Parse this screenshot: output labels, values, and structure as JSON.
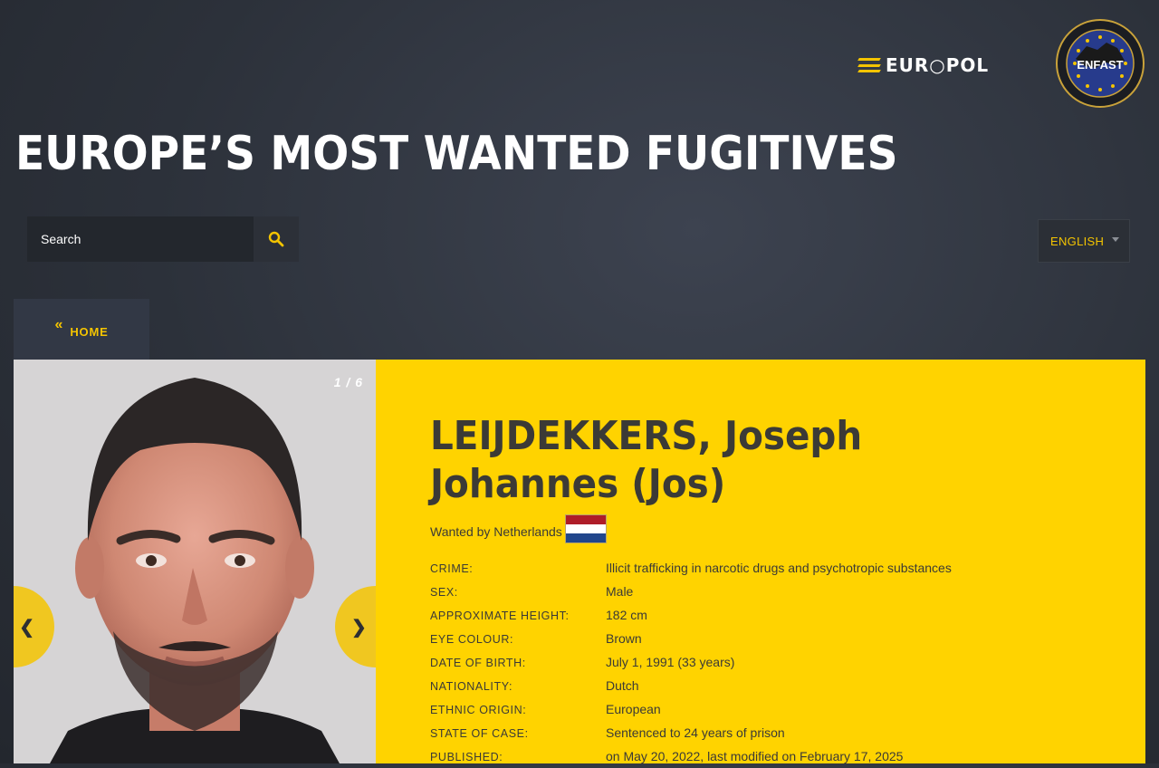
{
  "header": {
    "europol_logo_text": "EUR○POL",
    "enfast_logo_text": "ENFAST",
    "enfast_ring_text": "EUROPEAN NETWORK · FUGITIVE ACTIVE SEARCH TEAMS"
  },
  "page_title": "EUROPE’S MOST WANTED FUGITIVES",
  "search": {
    "placeholder": "Search",
    "icon": "search-icon"
  },
  "language": {
    "selected": "ENGLISH"
  },
  "nav": {
    "home_chevron": "«",
    "home_label": "HOME"
  },
  "gallery": {
    "counter": "1 / 6",
    "prev": "❮",
    "next": "❯"
  },
  "fugitive": {
    "name": "LEIJDEKKERS, Joseph Johannes (Jos)",
    "wanted_by": "Wanted by Netherlands",
    "flag_colors": [
      "#ae1c28",
      "#ffffff",
      "#21468b"
    ],
    "facts": [
      {
        "label": "CRIME:",
        "value": "Illicit trafficking in narcotic drugs and psychotropic substances"
      },
      {
        "label": "SEX:",
        "value": "Male"
      },
      {
        "label": "APPROXIMATE HEIGHT:",
        "value": "182 cm"
      },
      {
        "label": "EYE COLOUR:",
        "value": "Brown"
      },
      {
        "label": "DATE OF BIRTH:",
        "value": "July 1, 1991 (33 years)"
      },
      {
        "label": "NATIONALITY:",
        "value": "Dutch"
      },
      {
        "label": "ETHNIC ORIGIN:",
        "value": "European"
      },
      {
        "label": "STATE OF CASE:",
        "value": "Sentenced to 24 years of prison"
      },
      {
        "label": "PUBLISHED:",
        "value": "on May 20, 2022, last modified on February 17, 2025"
      }
    ]
  },
  "colors": {
    "accent": "#ffd300",
    "background": "#2c313a",
    "panel": "#323845"
  }
}
